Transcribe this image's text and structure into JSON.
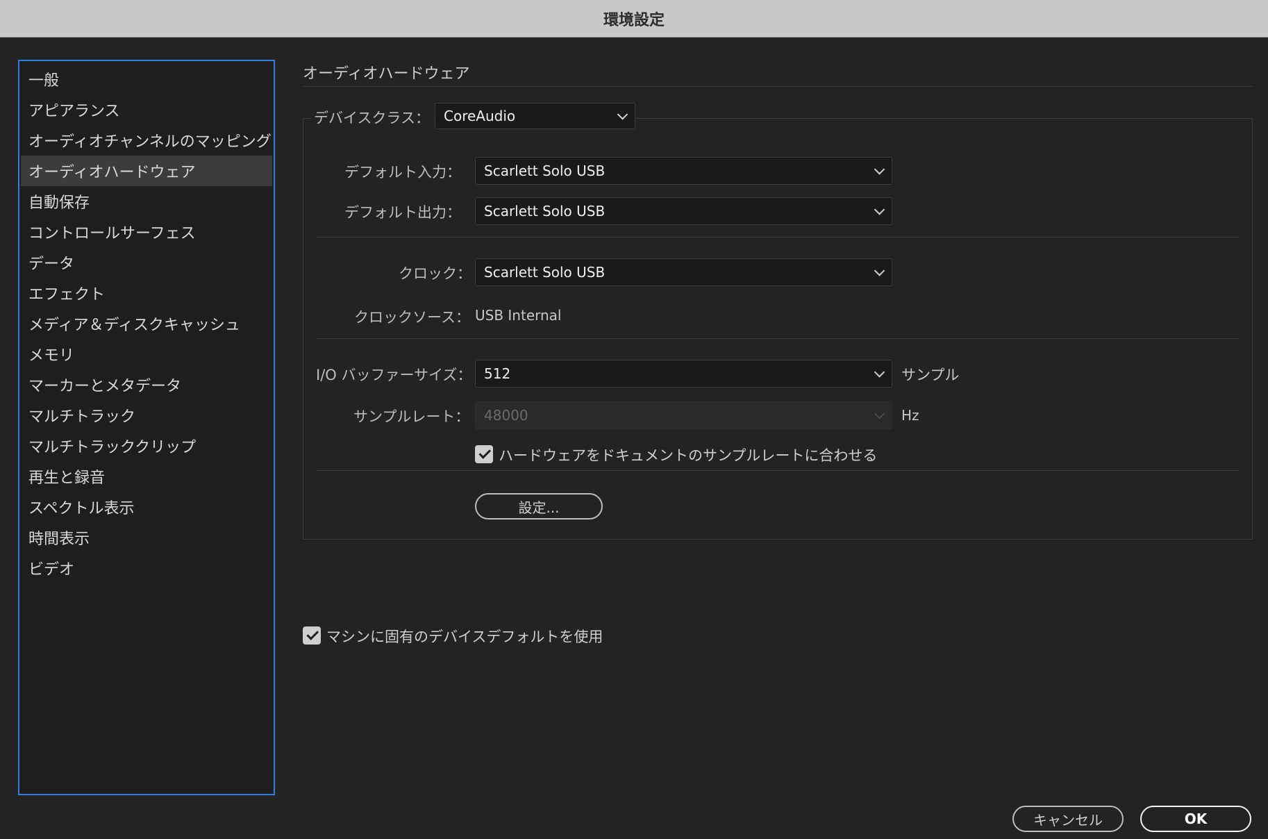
{
  "window": {
    "title": "環境設定"
  },
  "sidebar": {
    "items": [
      {
        "label": "一般"
      },
      {
        "label": "アピアランス"
      },
      {
        "label": "オーディオチャンネルのマッピング"
      },
      {
        "label": "オーディオハードウェア",
        "selected": true
      },
      {
        "label": "自動保存"
      },
      {
        "label": "コントロールサーフェス"
      },
      {
        "label": "データ"
      },
      {
        "label": "エフェクト"
      },
      {
        "label": "メディア＆ディスクキャッシュ"
      },
      {
        "label": "メモリ"
      },
      {
        "label": "マーカーとメタデータ"
      },
      {
        "label": "マルチトラック"
      },
      {
        "label": "マルチトラッククリップ"
      },
      {
        "label": "再生と録音"
      },
      {
        "label": "スペクトル表示"
      },
      {
        "label": "時間表示"
      },
      {
        "label": "ビデオ"
      }
    ]
  },
  "main": {
    "section_title": "オーディオハードウェア",
    "device_class": {
      "label": "デバイスクラス：",
      "value": "CoreAudio"
    },
    "default_input": {
      "label": "デフォルト入力：",
      "value": "Scarlett Solo USB"
    },
    "default_output": {
      "label": "デフォルト出力：",
      "value": "Scarlett Solo USB"
    },
    "clock": {
      "label": "クロック：",
      "value": "Scarlett Solo USB"
    },
    "clock_source": {
      "label": "クロックソース：",
      "value": "USB Internal"
    },
    "io_buffer": {
      "label": "I/O バッファーサイズ：",
      "value": "512",
      "unit": "サンプル"
    },
    "sample_rate": {
      "label": "サンプルレート：",
      "value": "48000",
      "unit": "Hz",
      "disabled": true
    },
    "match_hw_rate": {
      "label": "ハードウェアをドキュメントのサンプルレートに合わせる",
      "checked": true
    },
    "settings_button": "設定...",
    "use_machine_defaults": {
      "label": "マシンに固有のデバイスデフォルトを使用",
      "checked": true
    }
  },
  "footer": {
    "cancel_label": "キャンセル",
    "ok_label": "OK"
  }
}
